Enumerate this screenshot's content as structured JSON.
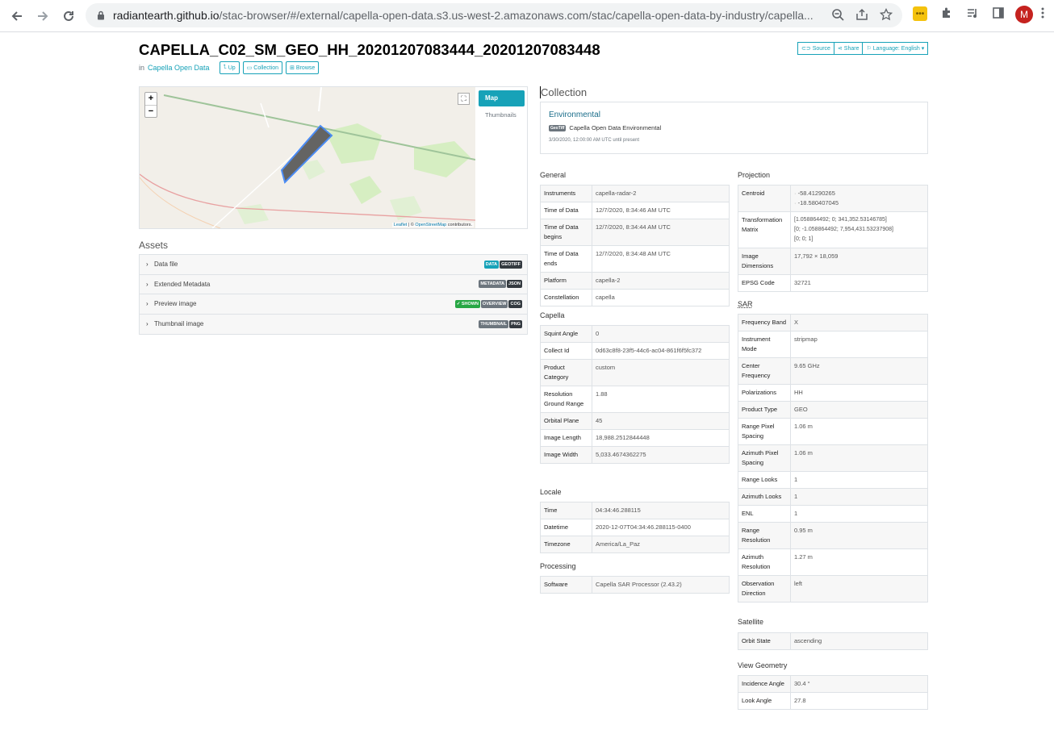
{
  "browser": {
    "url_host": "radiantearth.github.io",
    "url_rest": "/stac-browser/#/external/capella-open-data.s3.us-west-2.amazonaws.com/stac/capella-open-data-by-industry/capella...",
    "avatar_letter": "M"
  },
  "page": {
    "title": "CAPELLA_C02_SM_GEO_HH_20201207083444_20201207083448",
    "in_label": "in",
    "parent_link": "Capella Open Data",
    "btn_up": "Up",
    "btn_collection": "Collection",
    "btn_browse": "Browse",
    "btn_source": "Source",
    "btn_share": "Share",
    "btn_language": "Language: English"
  },
  "map": {
    "zoom_in": "+",
    "zoom_out": "−",
    "tab_map": "Map",
    "tab_thumbnails": "Thumbnails",
    "attrib_leaflet": "Leaflet",
    "attrib_sep": " | © ",
    "attrib_osm": "OpenStreetMap",
    "attrib_tail": " contributors."
  },
  "assets": {
    "heading": "Assets",
    "items": [
      {
        "name": "Data file",
        "badges": [
          {
            "text": "DATA",
            "color": "#17a2b8"
          },
          {
            "text": "GEOTIFF",
            "color": "#343a40"
          }
        ]
      },
      {
        "name": "Extended Metadata",
        "badges": [
          {
            "text": "METADATA",
            "color": "#6c757d"
          },
          {
            "text": "JSON",
            "color": "#343a40"
          }
        ]
      },
      {
        "name": "Preview image",
        "badges": [
          {
            "text": "✓ SHOWN",
            "color": "#28a745"
          },
          {
            "text": "OVERVIEW",
            "color": "#6c757d"
          },
          {
            "text": "COG",
            "color": "#343a40"
          }
        ]
      },
      {
        "name": "Thumbnail image",
        "badges": [
          {
            "text": "THUMBNAIL",
            "color": "#6c757d"
          },
          {
            "text": "PNG",
            "color": "#343a40"
          }
        ]
      }
    ]
  },
  "collection": {
    "heading": "Collection",
    "name": "Environmental",
    "badge": "GeoTiff",
    "description": "Capella Open Data Environmental",
    "date": "3/30/2020, 12:00:00 AM UTC until present"
  },
  "general": {
    "heading": "General",
    "rows": [
      [
        "Instruments",
        "capella-radar-2"
      ],
      [
        "Time of Data",
        "12/7/2020, 8:34:46 AM UTC"
      ],
      [
        "Time of Data begins",
        "12/7/2020, 8:34:44 AM UTC"
      ],
      [
        "Time of Data ends",
        "12/7/2020, 8:34:48 AM UTC"
      ],
      [
        "Platform",
        "capella-2"
      ],
      [
        "Constellation",
        "capella"
      ]
    ]
  },
  "capella": {
    "heading": "Capella",
    "rows": [
      [
        "Squint Angle",
        "0"
      ],
      [
        "Collect Id",
        "0d63c8f8-23f5-44c6-ac04-861f6f5fc372"
      ],
      [
        "Product Category",
        "custom"
      ],
      [
        "Resolution Ground Range",
        "1.88"
      ],
      [
        "Orbital Plane",
        "45"
      ],
      [
        "Image Length",
        "18,988.2512844448"
      ],
      [
        "Image Width",
        "5,033.4674362275"
      ]
    ]
  },
  "locale": {
    "heading": "Locale",
    "rows": [
      [
        "Time",
        "04:34:46.288115"
      ],
      [
        "Datetime",
        "2020-12-07T04:34:46.288115-0400"
      ],
      [
        "Timezone",
        "America/La_Paz"
      ]
    ]
  },
  "processing": {
    "heading": "Processing",
    "rows": [
      [
        "Software",
        "Capella SAR Processor (2.43.2)"
      ]
    ]
  },
  "projection": {
    "heading": "Projection",
    "centroid_label": "Centroid",
    "centroid_lines": [
      "-58.41290265",
      "-18.580407045"
    ],
    "transform_label": "Transformation Matrix",
    "transform_lines": [
      "[1.058864492; 0; 341,352.53146785]",
      "[0; -1.058864492; 7,954,431.53237908]",
      "[0; 0; 1]"
    ],
    "dims_label": "Image Dimensions",
    "dims_value": "17,792 × 18,059",
    "epsg_label": "EPSG Code",
    "epsg_value": "32721"
  },
  "sar": {
    "heading": "SAR",
    "rows": [
      [
        "Frequency Band",
        "X"
      ],
      [
        "Instrument Mode",
        "stripmap"
      ],
      [
        "Center Frequency",
        "9.65 GHz"
      ],
      [
        "Polarizations",
        "HH"
      ],
      [
        "Product Type",
        "GEO"
      ],
      [
        "Range Pixel Spacing",
        "1.06 m"
      ],
      [
        "Azimuth Pixel Spacing",
        "1.06 m"
      ],
      [
        "Range Looks",
        "1"
      ],
      [
        "Azimuth Looks",
        "1"
      ],
      [
        "ENL",
        "1"
      ],
      [
        "Range Resolution",
        "0.95 m"
      ],
      [
        "Azimuth Resolution",
        "1.27 m"
      ],
      [
        "Observation Direction",
        "left"
      ]
    ]
  },
  "satellite": {
    "heading": "Satellite",
    "rows": [
      [
        "Orbit State",
        "ascending"
      ]
    ]
  },
  "view": {
    "heading": "View Geometry",
    "rows": [
      [
        "Incidence Angle",
        "30.4 °"
      ],
      [
        "Look Angle",
        "27.8"
      ]
    ]
  }
}
